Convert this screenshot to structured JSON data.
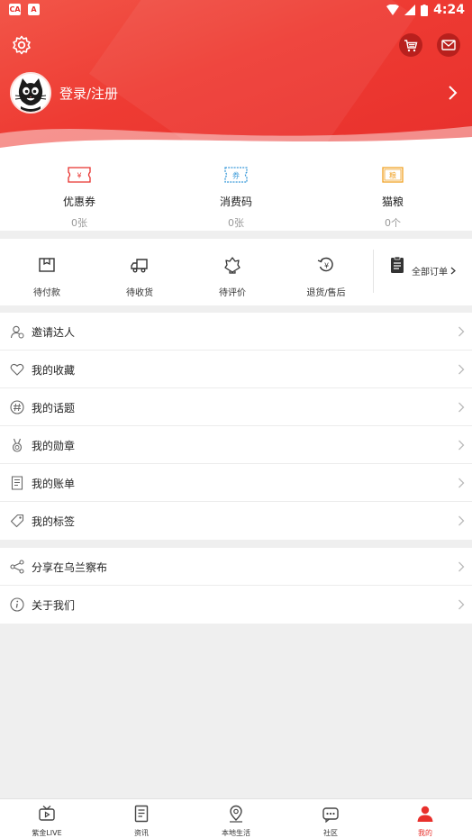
{
  "status_bar": {
    "time": "4:24",
    "badges": [
      "CA",
      "A"
    ]
  },
  "header": {
    "login_label": "登录/注册"
  },
  "assets": [
    {
      "name": "优惠券",
      "value": "0张",
      "icon": "coupon-icon",
      "icon_text": "¥",
      "color": "#e8302c"
    },
    {
      "name": "消费码",
      "value": "0张",
      "icon": "ticket-code-icon",
      "icon_text": "券",
      "color": "#3a9ad9"
    },
    {
      "name": "猫粮",
      "value": "0个",
      "icon": "cat-food-icon",
      "icon_text": "粮",
      "color": "#f0a020"
    }
  ],
  "orders": [
    {
      "label": "待付款",
      "icon": "pending-payment-icon"
    },
    {
      "label": "待收货",
      "icon": "delivery-truck-icon"
    },
    {
      "label": "待评价",
      "icon": "review-icon"
    },
    {
      "label": "退货/售后",
      "icon": "refund-icon"
    },
    {
      "label": "全部订单",
      "icon": "clipboard-icon"
    }
  ],
  "menu_primary": [
    {
      "label": "邀请达人",
      "icon": "invite-user-icon"
    },
    {
      "label": "我的收藏",
      "icon": "heart-icon"
    },
    {
      "label": "我的话题",
      "icon": "hashtag-icon"
    },
    {
      "label": "我的勋章",
      "icon": "medal-icon"
    },
    {
      "label": "我的账单",
      "icon": "bill-icon"
    },
    {
      "label": "我的标签",
      "icon": "tag-icon"
    }
  ],
  "menu_secondary": [
    {
      "label": "分享在乌兰察布",
      "icon": "share-icon"
    },
    {
      "label": "关于我们",
      "icon": "info-icon"
    }
  ],
  "tabs": [
    {
      "label": "紫金LIVE",
      "icon": "tv-icon",
      "active": false
    },
    {
      "label": "资讯",
      "icon": "news-icon",
      "active": false
    },
    {
      "label": "本地生活",
      "icon": "location-icon",
      "active": false
    },
    {
      "label": "社区",
      "icon": "community-icon",
      "active": false
    },
    {
      "label": "我的",
      "icon": "profile-icon",
      "active": true
    }
  ],
  "colors": {
    "brand_red": "#e8302c",
    "background": "#efefef"
  }
}
